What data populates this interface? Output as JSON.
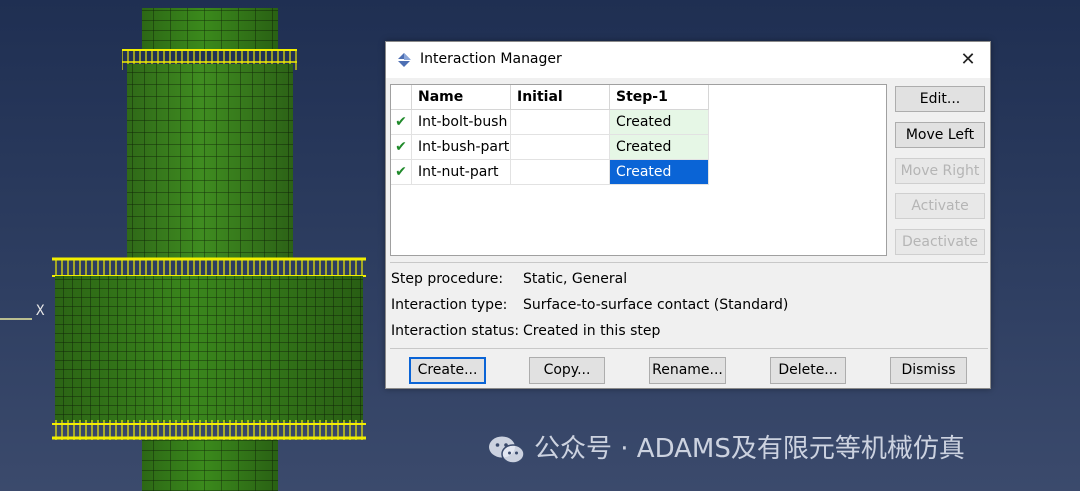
{
  "viewport": {
    "axis_label": "X",
    "colors": {
      "mesh_green": "#3d8a1e",
      "mesh_line": "#17360a",
      "highlight": "#f2ee00",
      "background": "#2a3a5c"
    }
  },
  "dialog": {
    "title": "Interaction Manager",
    "icon": "interaction-manager-icon",
    "close_label": "✕",
    "table": {
      "headers": [
        "",
        "Name",
        "Initial",
        "Step-1"
      ],
      "rows": [
        {
          "check": "✔",
          "name": "Int-bolt-bush",
          "initial": "",
          "step1": "Created"
        },
        {
          "check": "✔",
          "name": "Int-bush-part",
          "initial": "",
          "step1": "Created"
        },
        {
          "check": "✔",
          "name": "Int-nut-part",
          "initial": "",
          "step1": "Created"
        }
      ]
    },
    "side_buttons": {
      "edit": "Edit...",
      "move_left": "Move Left",
      "move_right": "Move Right",
      "activate": "Activate",
      "deactivate": "Deactivate"
    },
    "info": {
      "step_procedure_label": "Step procedure:",
      "step_procedure_value": "Static, General",
      "interaction_type_label": "Interaction type:",
      "interaction_type_value": "Surface-to-surface contact (Standard)",
      "interaction_status_label": "Interaction status:",
      "interaction_status_value": "Created in this step"
    },
    "bottom_buttons": {
      "create": "Create...",
      "copy": "Copy...",
      "rename": "Rename...",
      "delete": "Delete...",
      "dismiss": "Dismiss"
    }
  },
  "watermark": {
    "text": "公众号 · ADAMS及有限元等机械仿真",
    "icon": "wechat-icon"
  }
}
